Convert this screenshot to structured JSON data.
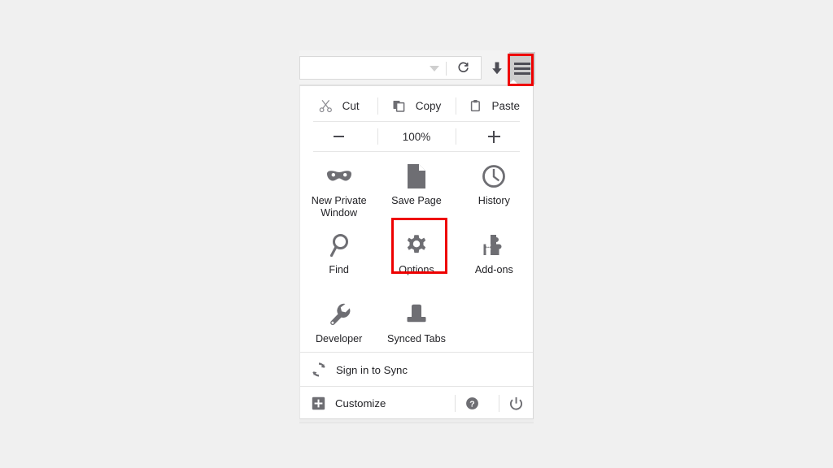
{
  "theme": {
    "page_background": "#f0f0f0",
    "panel_background": "#ffffff",
    "toolbar_background": "#f3f3f3",
    "icon_gray": "#6e6e73",
    "text_color": "#222226",
    "highlight_color": "#ee0000",
    "divider_color": "#e4e4e4"
  },
  "toolbar": {
    "url_input_value": "",
    "url_input_placeholder": "",
    "dropdown_icon": "chevron-down-icon",
    "reload_icon": "reload-icon",
    "download_icon": "download-arrow-icon",
    "menu_button_icon": "hamburger-menu-icon",
    "menu_button_label": "Open menu"
  },
  "panel": {
    "edit_row": {
      "items": [
        {
          "label": "Cut",
          "icon": "scissors-icon"
        },
        {
          "label": "Copy",
          "icon": "copy-icon"
        },
        {
          "label": "Paste",
          "icon": "clipboard-icon"
        }
      ]
    },
    "zoom_row": {
      "zoom_out_label": "−",
      "zoom_out_icon": "minus-icon",
      "zoom_level": "100%",
      "zoom_in_label": "+",
      "zoom_in_icon": "plus-icon"
    },
    "grid_items": [
      {
        "label": "New Private Window",
        "icon": "mask-icon"
      },
      {
        "label": "Save Page",
        "icon": "page-icon"
      },
      {
        "label": "History",
        "icon": "clock-icon"
      },
      {
        "label": "Find",
        "icon": "magnifier-icon"
      },
      {
        "label": "Options",
        "icon": "gear-icon"
      },
      {
        "label": "Add-ons",
        "icon": "puzzle-piece-icon"
      },
      {
        "label": "Developer",
        "icon": "wrench-icon"
      },
      {
        "label": "Synced Tabs",
        "icon": "device-icon"
      }
    ],
    "sync_row": {
      "label": "Sign in to Sync",
      "icon": "sync-icon"
    },
    "customize_row": {
      "label": "Customize",
      "icon": "plus-square-icon",
      "help_icon": "question-mark-icon",
      "help_label": "Help",
      "power_icon": "power-icon",
      "power_label": "Quit"
    }
  },
  "highlights": [
    {
      "name": "hamburger-menu-button",
      "color": "#ee0000"
    },
    {
      "name": "options-grid-item",
      "color": "#ee0000"
    }
  ]
}
